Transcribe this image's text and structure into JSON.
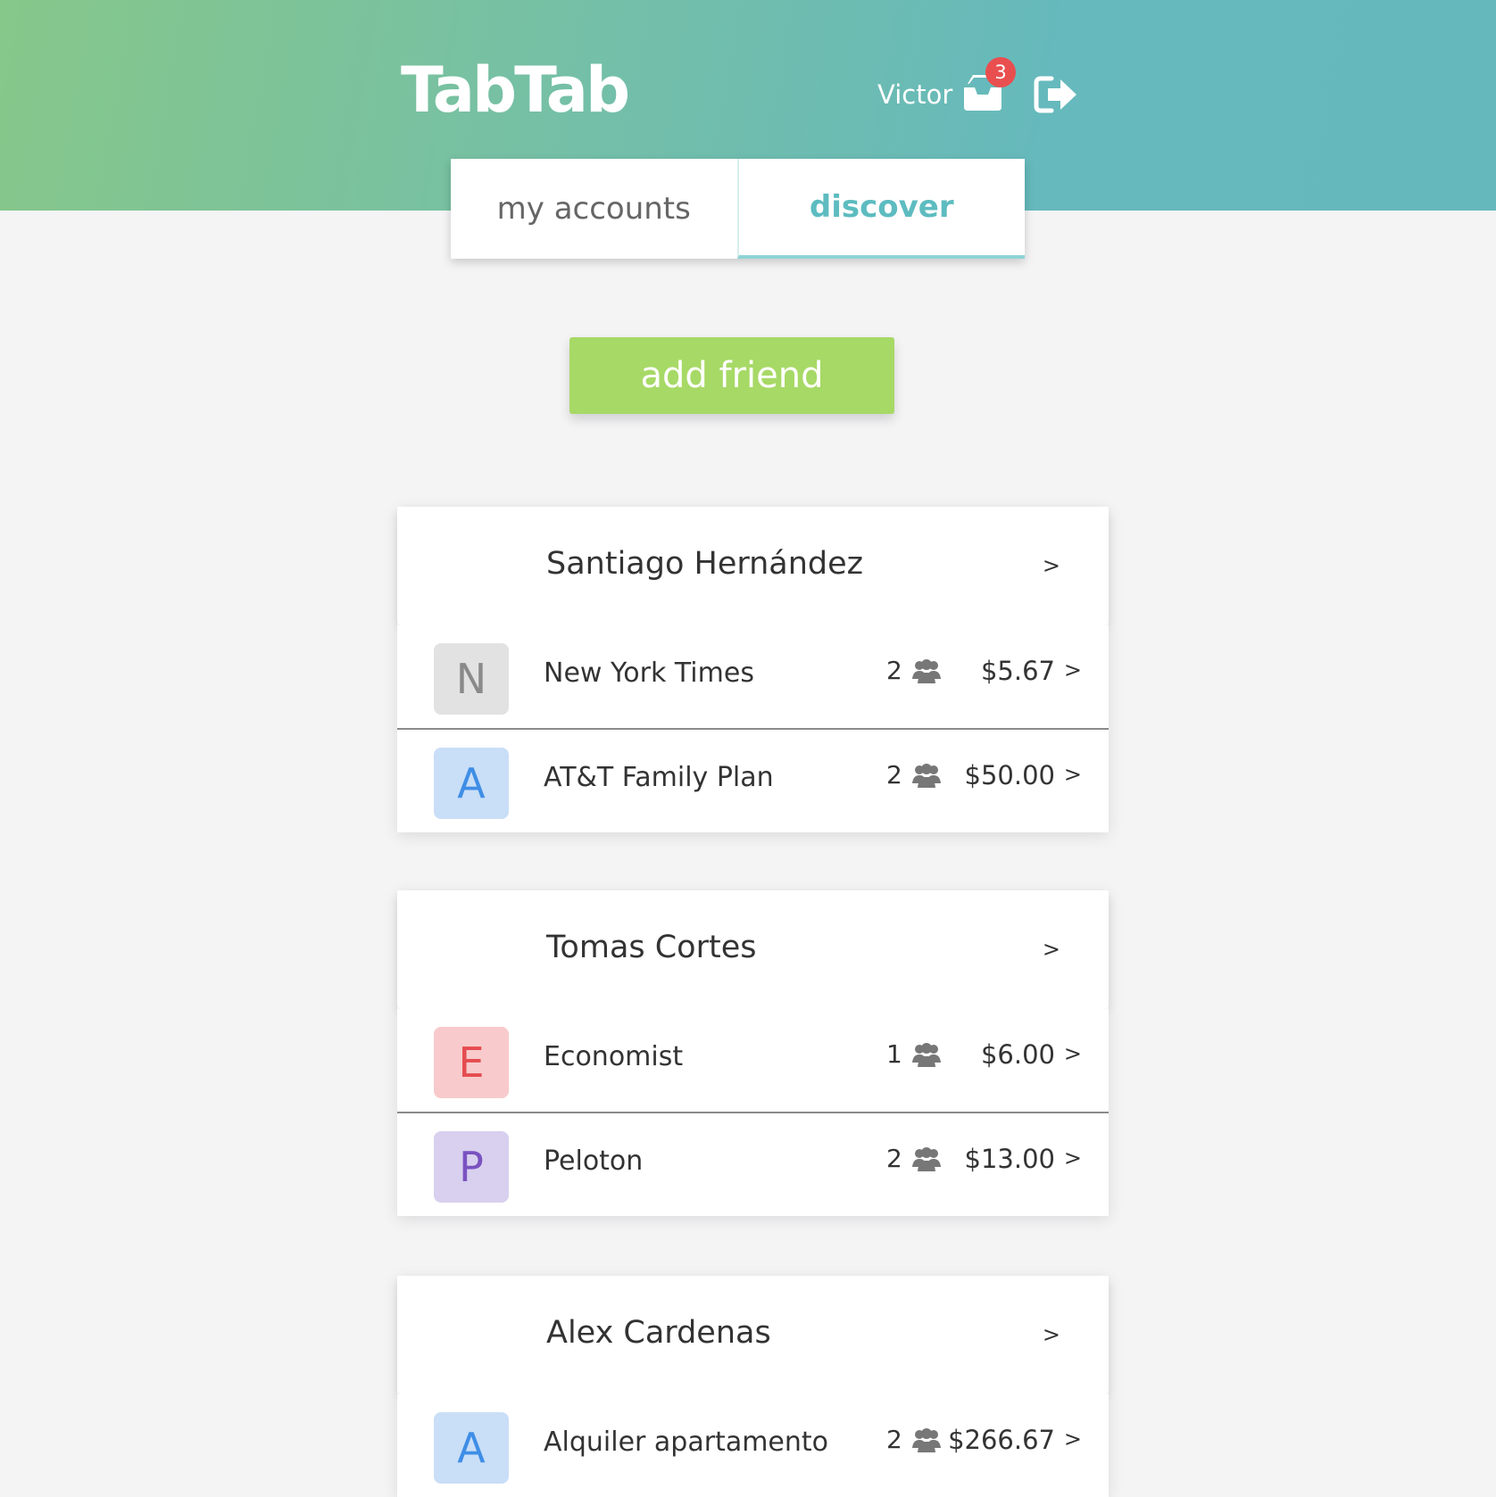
{
  "header": {
    "logo": "TabTab",
    "user_name": "Victor",
    "notification_count": "3"
  },
  "tabs": [
    {
      "label": "my accounts",
      "active": false
    },
    {
      "label": "discover",
      "active": true
    }
  ],
  "actions": {
    "add_friend_label": "add friend"
  },
  "friends": [
    {
      "name": "Santiago Hernández",
      "chevron": ">",
      "accounts": [
        {
          "letter": "N",
          "name": "New York Times",
          "members": "2",
          "amount": "$5.67",
          "chevron": ">"
        },
        {
          "letter": "A",
          "name": "AT&T Family Plan",
          "members": "2",
          "amount": "$50.00",
          "chevron": ">"
        }
      ]
    },
    {
      "name": "Tomas Cortes",
      "chevron": ">",
      "accounts": [
        {
          "letter": "E",
          "name": "Economist",
          "members": "1",
          "amount": "$6.00",
          "chevron": ">"
        },
        {
          "letter": "P",
          "name": "Peloton",
          "members": "2",
          "amount": "$13.00",
          "chevron": ">"
        }
      ]
    },
    {
      "name": "Alex Cardenas",
      "chevron": ">",
      "accounts": [
        {
          "letter": "A",
          "name": "Alquiler apartamento",
          "members": "2",
          "amount": "$266.67",
          "chevron": ">"
        }
      ]
    }
  ],
  "colors": {
    "header_gradient_start": "#86c78a",
    "header_gradient_end": "#65b9bd",
    "active_tab": "#5dbcc0",
    "add_friend": "#a7d966",
    "badge": "#e94f4f",
    "letter_n_bg": "#e2e2e2",
    "letter_n_fg": "#8a8a8a",
    "letter_a_bg": "#c9def7",
    "letter_a_fg": "#3f8ee6",
    "letter_e_bg": "#f8cacb",
    "letter_e_fg": "#e54c4f",
    "letter_p_bg": "#d8d0ee",
    "letter_p_fg": "#7a52c0"
  },
  "icons": {
    "inbox": "inbox-icon",
    "logout": "sign-out-icon",
    "members": "users-icon"
  }
}
